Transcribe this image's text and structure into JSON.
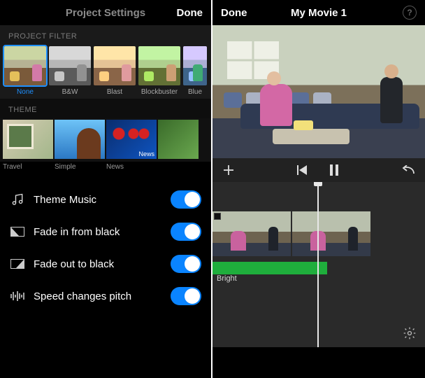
{
  "left": {
    "header": {
      "title": "Project Settings",
      "done": "Done"
    },
    "sections": {
      "project_filter": {
        "label": "PROJECT FILTER",
        "items": [
          {
            "label": "None",
            "selected": true
          },
          {
            "label": "B&W"
          },
          {
            "label": "Blast"
          },
          {
            "label": "Blockbuster"
          },
          {
            "label": "Blue"
          }
        ]
      },
      "theme": {
        "label": "THEME",
        "items": [
          {
            "label": "Travel"
          },
          {
            "label": "Simple"
          },
          {
            "label": "News"
          }
        ]
      }
    },
    "options": [
      {
        "label": "Theme Music",
        "on": true,
        "icon": "music-note-icon"
      },
      {
        "label": "Fade in from black",
        "on": true,
        "icon": "fade-in-icon"
      },
      {
        "label": "Fade out to black",
        "on": true,
        "icon": "fade-out-icon"
      },
      {
        "label": "Speed changes pitch",
        "on": true,
        "icon": "waveform-icon"
      }
    ]
  },
  "right": {
    "header": {
      "done": "Done",
      "title": "My Movie 1"
    },
    "timeline": {
      "audio_label": "Bright"
    }
  }
}
